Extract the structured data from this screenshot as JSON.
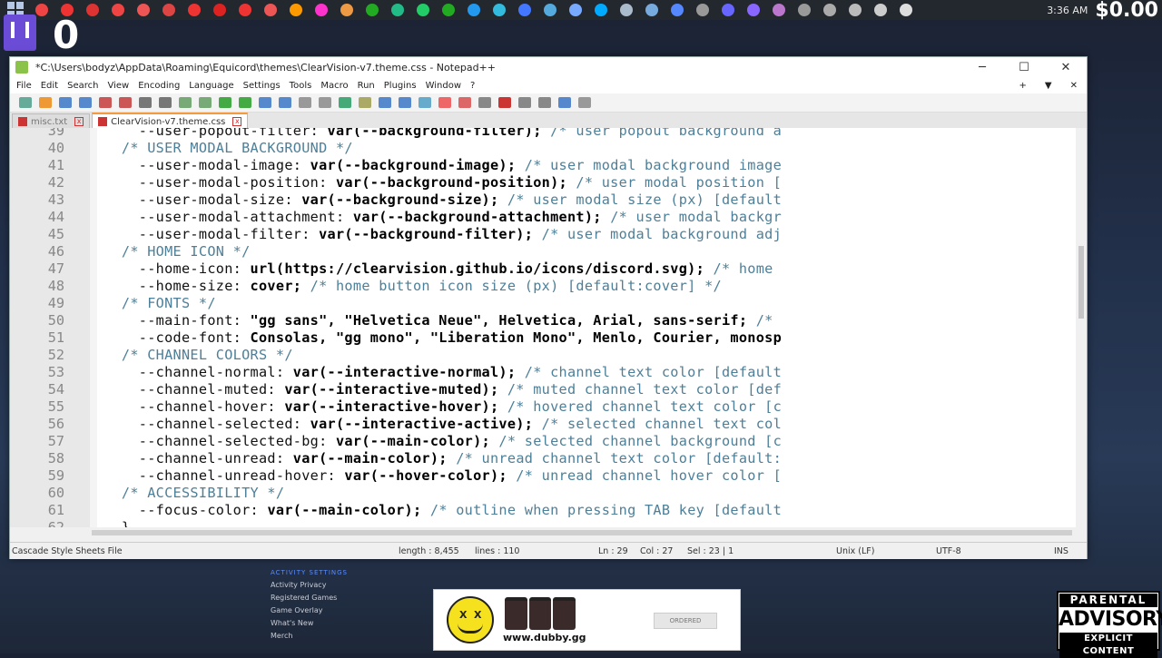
{
  "taskbar": {
    "icon_colors": [
      "#e44",
      "#e33",
      "#d33",
      "#e44",
      "#e55",
      "#d44",
      "#e33",
      "#d22",
      "#e33",
      "#e55",
      "#f90",
      "#f3c",
      "#e94",
      "#2a2",
      "#2b8",
      "#2c6",
      "#2a2",
      "#29e",
      "#3bd",
      "#47f",
      "#5ad",
      "#7af",
      "#0af",
      "#abc",
      "#7ad",
      "#58f",
      "#999",
      "#66f",
      "#86f",
      "#b7c",
      "#999",
      "#aaa",
      "#bbb",
      "#ccc",
      "#ddd"
    ],
    "clock": "3:36 AM",
    "money": "$0.00"
  },
  "stream": {
    "viewer_count": "0"
  },
  "window": {
    "title": "*C:\\Users\\bodyz\\AppData\\Roaming\\Equicord\\themes\\ClearVision-v7.theme.css - Notepad++",
    "minimize": "─",
    "maximize": "☐",
    "close": "✕",
    "menu": [
      "File",
      "Edit",
      "Search",
      "View",
      "Encoding",
      "Language",
      "Settings",
      "Tools",
      "Macro",
      "Run",
      "Plugins",
      "Window",
      "?"
    ],
    "menu_right": [
      "+",
      "▼",
      "✕"
    ],
    "tabs": [
      {
        "label": "misc.txt",
        "active": false
      },
      {
        "label": "ClearVision-v7.theme.css",
        "active": true
      }
    ]
  },
  "editor": {
    "lines": [
      {
        "num": "39",
        "prop": "    --user-popout-filter: ",
        "val": "var(--background-filter);",
        "cm": " /* user popout background a"
      },
      {
        "num": "40",
        "prop": "",
        "val": "",
        "cm": "  /* USER MODAL BACKGROUND */"
      },
      {
        "num": "41",
        "prop": "    --user-modal-image: ",
        "val": "var(--background-image);",
        "cm": " /* user modal background image"
      },
      {
        "num": "42",
        "prop": "    --user-modal-position: ",
        "val": "var(--background-position);",
        "cm": " /* user modal position ["
      },
      {
        "num": "43",
        "prop": "    --user-modal-size: ",
        "val": "var(--background-size);",
        "cm": " /* user modal size (px) [default"
      },
      {
        "num": "44",
        "prop": "    --user-modal-attachment: ",
        "val": "var(--background-attachment);",
        "cm": " /* user modal backgr"
      },
      {
        "num": "45",
        "prop": "    --user-modal-filter: ",
        "val": "var(--background-filter);",
        "cm": " /* user modal background adj"
      },
      {
        "num": "46",
        "prop": "",
        "val": "",
        "cm": "  /* HOME ICON */"
      },
      {
        "num": "47",
        "prop": "    --home-icon: ",
        "val": "url(https://clearvision.github.io/icons/discord.svg);",
        "cm": " /* home"
      },
      {
        "num": "48",
        "prop": "    --home-size: ",
        "val": "cover;",
        "cm": " /* home button icon size (px) [default:cover] */"
      },
      {
        "num": "49",
        "prop": "",
        "val": "",
        "cm": "  /* FONTS */"
      },
      {
        "num": "50",
        "prop": "    --main-font: ",
        "val": "\"gg sans\", \"Helvetica Neue\", Helvetica, Arial, sans-serif;",
        "cm": " /*"
      },
      {
        "num": "51",
        "prop": "    --code-font: ",
        "val": "Consolas, \"gg mono\", \"Liberation Mono\", Menlo, Courier, monosp",
        "cm": ""
      },
      {
        "num": "52",
        "prop": "",
        "val": "",
        "cm": "  /* CHANNEL COLORS */"
      },
      {
        "num": "53",
        "prop": "    --channel-normal: ",
        "val": "var(--interactive-normal);",
        "cm": " /* channel text color [default"
      },
      {
        "num": "54",
        "prop": "    --channel-muted: ",
        "val": "var(--interactive-muted);",
        "cm": " /* muted channel text color [def"
      },
      {
        "num": "55",
        "prop": "    --channel-hover: ",
        "val": "var(--interactive-hover);",
        "cm": " /* hovered channel text color [c"
      },
      {
        "num": "56",
        "prop": "    --channel-selected: ",
        "val": "var(--interactive-active);",
        "cm": " /* selected channel text col"
      },
      {
        "num": "57",
        "prop": "    --channel-selected-bg: ",
        "val": "var(--main-color);",
        "cm": " /* selected channel background [c"
      },
      {
        "num": "58",
        "prop": "    --channel-unread: ",
        "val": "var(--main-color);",
        "cm": " /* unread channel text color [default:"
      },
      {
        "num": "59",
        "prop": "    --channel-unread-hover: ",
        "val": "var(--hover-color);",
        "cm": " /* unread channel hover color ["
      },
      {
        "num": "60",
        "prop": "",
        "val": "",
        "cm": "  /* ACCESSIBILITY */"
      },
      {
        "num": "61",
        "prop": "    --focus-color: ",
        "val": "var(--main-color);",
        "cm": " /* outline when pressing TAB key [default"
      },
      {
        "num": "62",
        "prop": "  }",
        "val": "",
        "cm": ""
      }
    ]
  },
  "status": {
    "filetype": "Cascade Style Sheets File",
    "length": "length : 8,455",
    "lines": "lines : 110",
    "ln": "Ln : 29",
    "col": "Col : 27",
    "sel": "Sel : 23 | 1",
    "eol": "Unix (LF)",
    "encoding": "UTF-8",
    "mode": "INS"
  },
  "discord_menu": {
    "header": "ACTIVITY SETTINGS",
    "items": [
      "Activity Privacy",
      "Registered Games",
      "Game Overlay",
      "",
      "What's New",
      "Merch"
    ]
  },
  "ad": {
    "site": "www.dubby.gg",
    "button": "ORDERED"
  },
  "parental_advisory": {
    "line1": "PARENTAL",
    "line2": "ADVISORY",
    "line3": "EXPLICIT CONTENT"
  }
}
